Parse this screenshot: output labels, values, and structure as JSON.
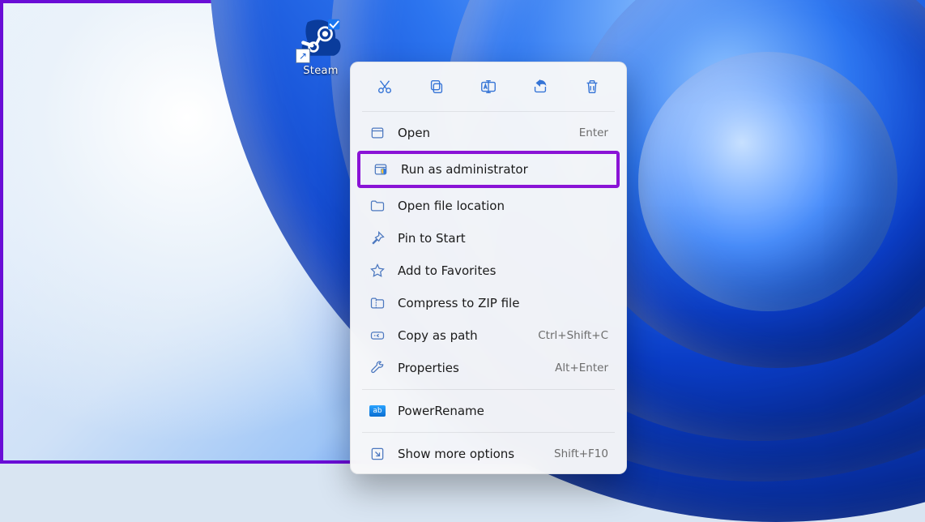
{
  "desktop_icon": {
    "label": "Steam"
  },
  "context_menu": {
    "action_row": [
      {
        "name": "cut-icon"
      },
      {
        "name": "copy-icon"
      },
      {
        "name": "rename-icon"
      },
      {
        "name": "share-icon"
      },
      {
        "name": "delete-icon"
      }
    ],
    "highlighted_index": 1,
    "items": [
      {
        "icon": "window-icon",
        "label": "Open",
        "accel": "Enter"
      },
      {
        "icon": "shield-icon",
        "label": "Run as administrator",
        "accel": ""
      },
      {
        "icon": "folder-icon",
        "label": "Open file location",
        "accel": ""
      },
      {
        "icon": "pin-icon",
        "label": "Pin to Start",
        "accel": ""
      },
      {
        "icon": "star-icon",
        "label": "Add to Favorites",
        "accel": ""
      },
      {
        "icon": "zip-icon",
        "label": "Compress to ZIP file",
        "accel": ""
      },
      {
        "icon": "path-icon",
        "label": "Copy as path",
        "accel": "Ctrl+Shift+C"
      },
      {
        "icon": "wrench-icon",
        "label": "Properties",
        "accel": "Alt+Enter"
      }
    ],
    "extra": {
      "icon": "powerrename-icon",
      "label": "PowerRename",
      "accel": ""
    },
    "more": {
      "icon": "expand-icon",
      "label": "Show more options",
      "accel": "Shift+F10"
    }
  }
}
